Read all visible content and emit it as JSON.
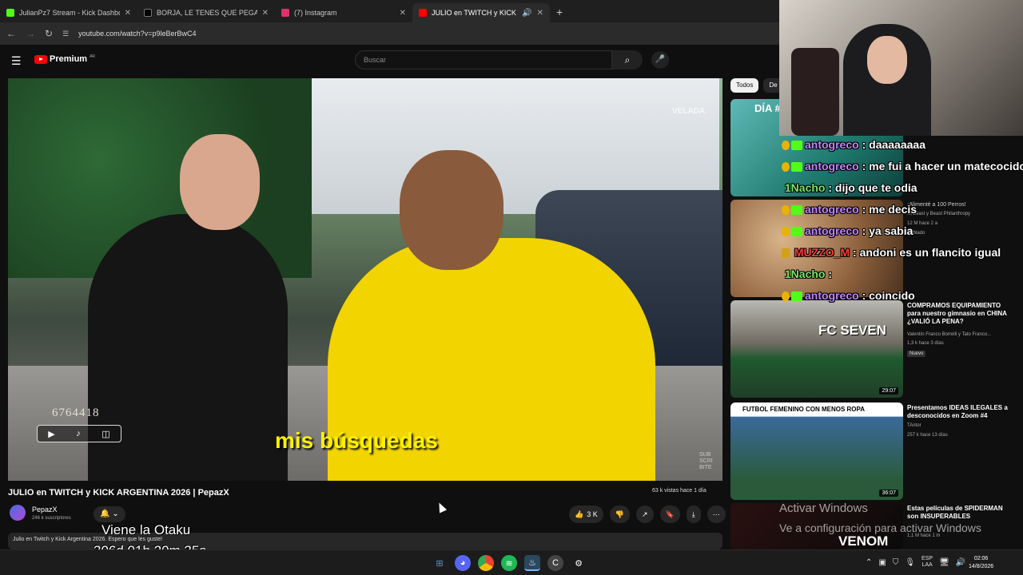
{
  "browser": {
    "tabs": [
      {
        "title": "JulianPz7 Stream - Kick Dashbo",
        "color": "#53fc18"
      },
      {
        "title": "BORJA, LE TENES QUE PEGAR A",
        "color": "#000000"
      },
      {
        "title": "(7) Instagram",
        "color": "#e1306c"
      },
      {
        "title": "JULIO en TWITCH y KICK AR",
        "color": "#ff0000"
      }
    ],
    "url": "youtube.com/watch?v=p9leBerBwC4"
  },
  "youtube": {
    "logo": "Premium",
    "logo_cc": "AR",
    "search_placeholder": "Buscar"
  },
  "video": {
    "subtitle": "mis búsquedas",
    "counter": "6764418",
    "watermark": "VELADA",
    "subscribe_text": "SUB SCRI BITE",
    "title": "JULIO en TWITCH y KICK ARGENTINA 2026 | PepazX",
    "views": "63 k vistas  hace 1 día",
    "channel": "PepazX",
    "channel_subs": "246 k suscriptores",
    "likes": "3 K",
    "description": "Julio en Twitch y Kick Argentina 2026. Espero que les guste!"
  },
  "overlay": {
    "title": "Viene la Otaku",
    "timer": "306d 01h 20m 35s"
  },
  "sidebar": {
    "chips": [
      "Todos",
      "De"
    ],
    "recs": [
      {
        "thumb_text": "DÍA #",
        "title": "",
        "meta1": "",
        "meta2": "",
        "duration": ""
      },
      {
        "thumb_text": "",
        "title": "¡Alimenté a 100 Perros!",
        "meta1": "MrBeast y Beast Philanthropy",
        "meta2": "12 M  hace 2 a",
        "duration": "",
        "extra": "Doblado"
      },
      {
        "thumb_text": "FC SEVEN",
        "title": "COMPRAMOS EQUIPAMIENTO para nuestro gimnasio en CHINA ¿VALIÓ LA PENA?",
        "meta1": "Valentín Franco Borrelli y Tato Franco...",
        "meta2": "1,3 k  hace 3 días",
        "duration": "29:07",
        "badge": "Nuevo"
      },
      {
        "thumb_text": "FUTBOL FEMENINO CON MENOS ROPA",
        "title": "Presentamos IDEAS ILEGALES a desconocidos en Zoom #4",
        "meta1": "TAntor",
        "meta2": "257 k  hace 13 días",
        "duration": "36:07"
      },
      {
        "thumb_text": "VENOM",
        "title": "Estas películas de SPIDERMAN son INSUPERABLES",
        "meta1": "",
        "meta2": "1,1 M  hace 1 m",
        "duration": ""
      }
    ]
  },
  "chat": [
    {
      "user": "antogreco",
      "text": "daaaaaaaa",
      "cls": "u1"
    },
    {
      "user": "antogreco",
      "text": "me fui a hacer un matecocido",
      "cls": "u1"
    },
    {
      "user": "1Nacho",
      "text": "dijo que te odia",
      "cls": "u2"
    },
    {
      "user": "antogreco",
      "text": "me decis",
      "cls": "u1"
    },
    {
      "user": "antogreco",
      "text": "ya sabia",
      "cls": "u1"
    },
    {
      "user": "MUZZO_M",
      "text": "andoni es un flancito igual",
      "cls": "u3"
    },
    {
      "user": "1Nacho",
      "text": "",
      "cls": "u2"
    },
    {
      "user": "antogreco",
      "text": "coincido",
      "cls": "u1"
    }
  ],
  "windows": {
    "activate_line1": "Activar Windows",
    "activate_line2": "Ve a configuración para activar Windows",
    "lang1": "ESP",
    "lang2": "LAA",
    "time": "02:06",
    "date": "14/8/2026"
  }
}
